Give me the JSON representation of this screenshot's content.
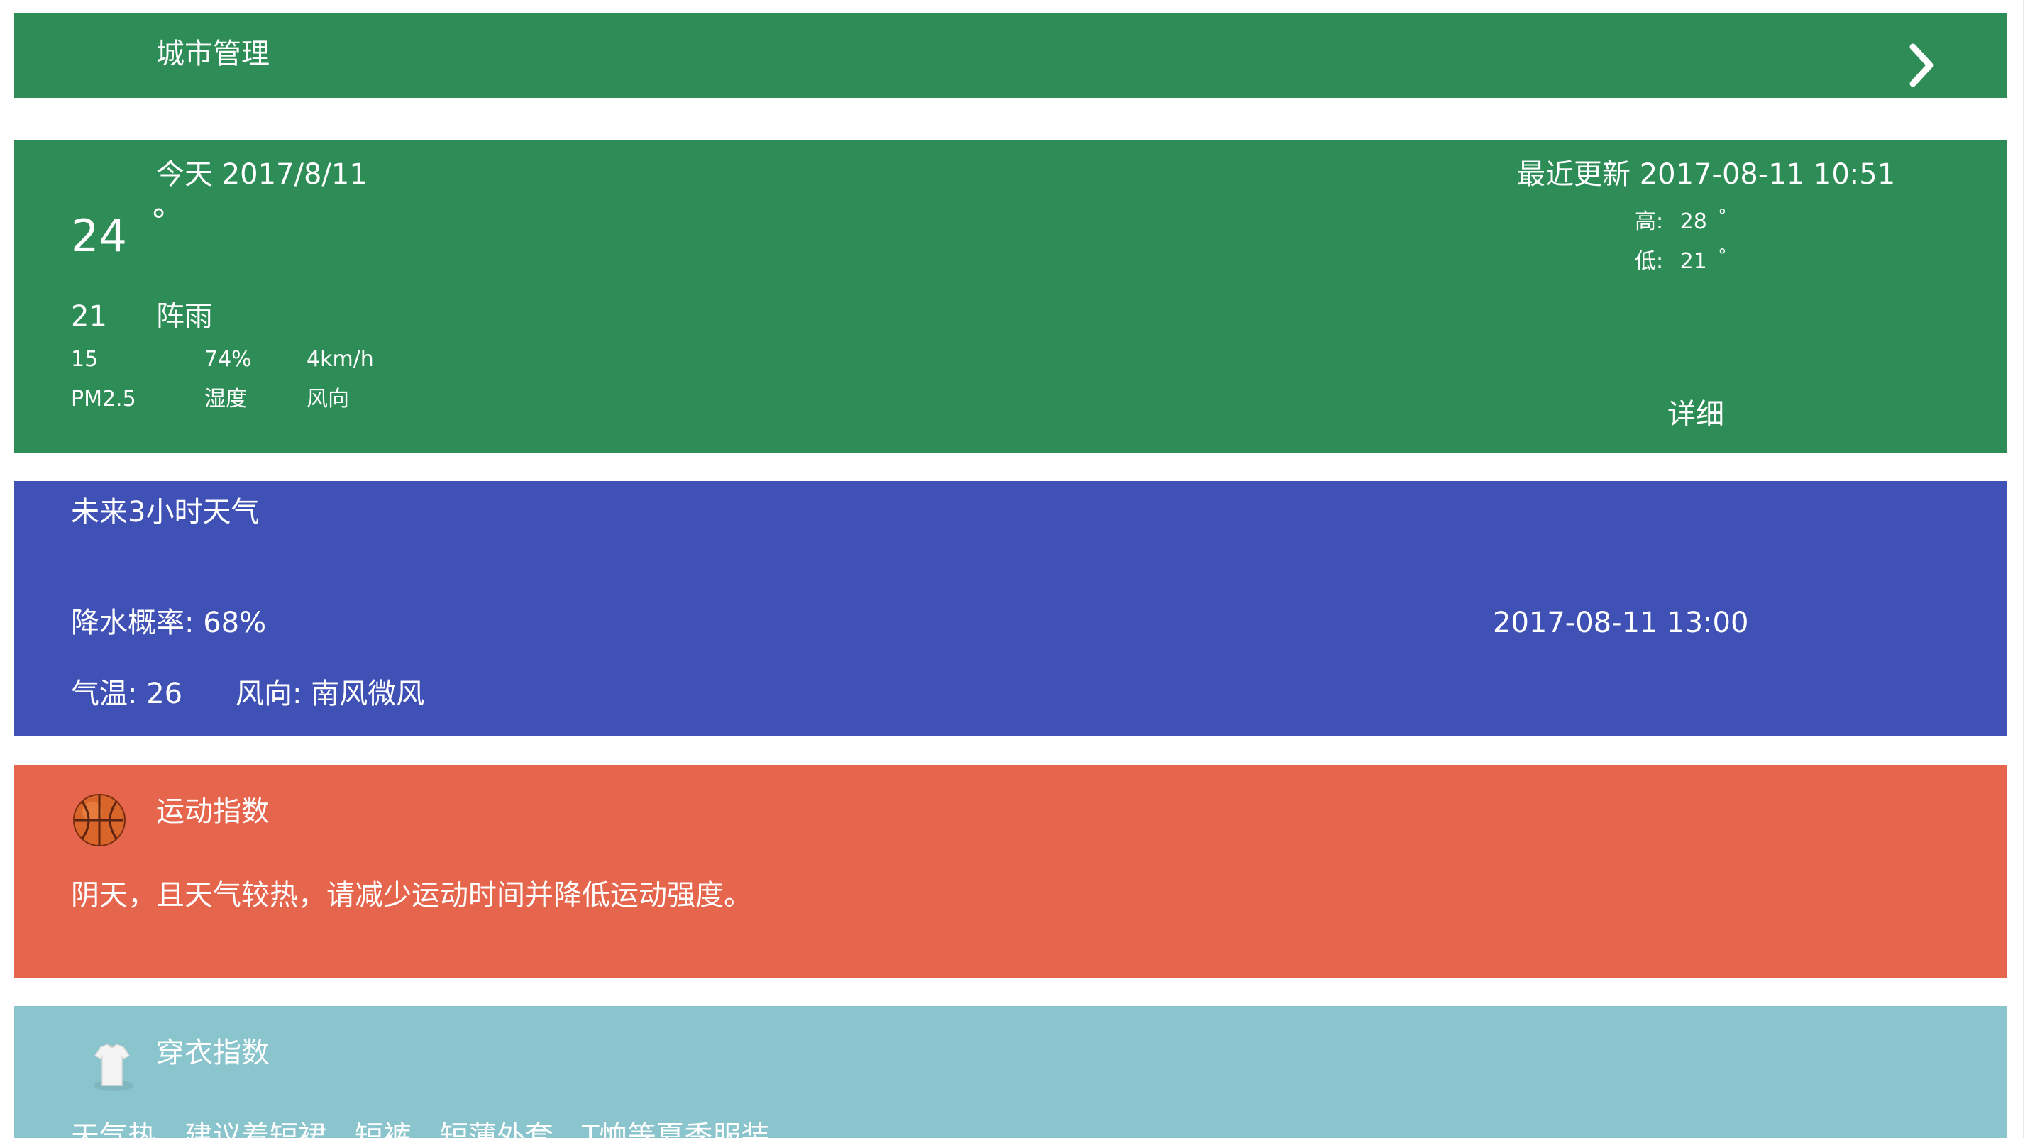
{
  "header": {
    "title": "城市管理"
  },
  "today": {
    "date_label": "今天 2017/8/11",
    "current_temp": "24",
    "degree": "°",
    "updated": "最近更新 2017-08-11 10:51",
    "high_label": "高:",
    "high_value": "28",
    "low_label": "低:",
    "low_value": "21",
    "aqi_number": "21",
    "condition": "阵雨",
    "stats": [
      {
        "value": "15",
        "label": "PM2.5"
      },
      {
        "value": "74%",
        "label": "湿度"
      },
      {
        "value": "4km/h",
        "label": "风向"
      }
    ],
    "detail_label": "详细"
  },
  "forecast": {
    "title": "未来3小时天气",
    "rain": "降水概率: 68%",
    "time": "2017-08-11 13:00",
    "temp": "气温: 26",
    "wind": "风向: 南风微风"
  },
  "sport": {
    "icon": "basketball-icon",
    "title": "运动指数",
    "text": "阴天，且天气较热，请减少运动时间并降低运动强度。"
  },
  "clothes": {
    "icon": "tshirt-icon",
    "title": "穿衣指数",
    "text": "天气热，建议着短裙、短裤、短薄外套、T恤等夏季服装。"
  },
  "colors": {
    "green": "#2e8d57",
    "blue": "#3f51b5",
    "red": "#e5654d",
    "teal": "#8ac4cc"
  }
}
